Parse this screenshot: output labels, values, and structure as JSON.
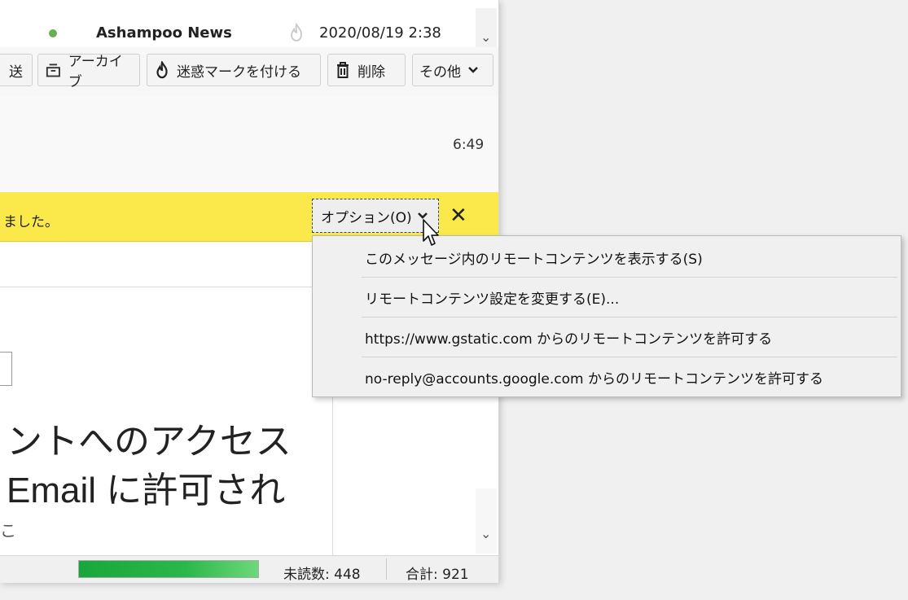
{
  "message_list": {
    "sender": "Ashampoo News",
    "date": "2020/08/19 2:38"
  },
  "toolbar": {
    "forward_partial": "送",
    "archive_label": "アーカイブ",
    "junk_label": "迷惑マークを付ける",
    "delete_label": "削除",
    "other_label": "その他"
  },
  "header": {
    "time": "6:49"
  },
  "notice": {
    "text_partial": "ました。",
    "options_label": "オプション(O)",
    "close_glyph": "✕"
  },
  "options_menu": {
    "items": [
      {
        "label": "このメッセージ内のリモートコンテンツを表示する(S)"
      },
      {
        "label": "リモートコンテンツ設定を変更する(E)..."
      },
      {
        "label": "https://www.gstatic.com からのリモートコンテンツを許可する"
      },
      {
        "label": "no-reply@accounts.google.com からのリモートコンテンツを許可する"
      }
    ]
  },
  "body": {
    "line1": "ントへのアクセス",
    "line2": "Email に許可され",
    "line3_partial": "こ"
  },
  "status_bar": {
    "unread": "未読数: 448",
    "total": "合計: 921",
    "progress": 1.0
  },
  "colors": {
    "notice_bg": "#fbe94b",
    "progress_green": "#2bb84a",
    "online_dot": "#6ab04c"
  }
}
